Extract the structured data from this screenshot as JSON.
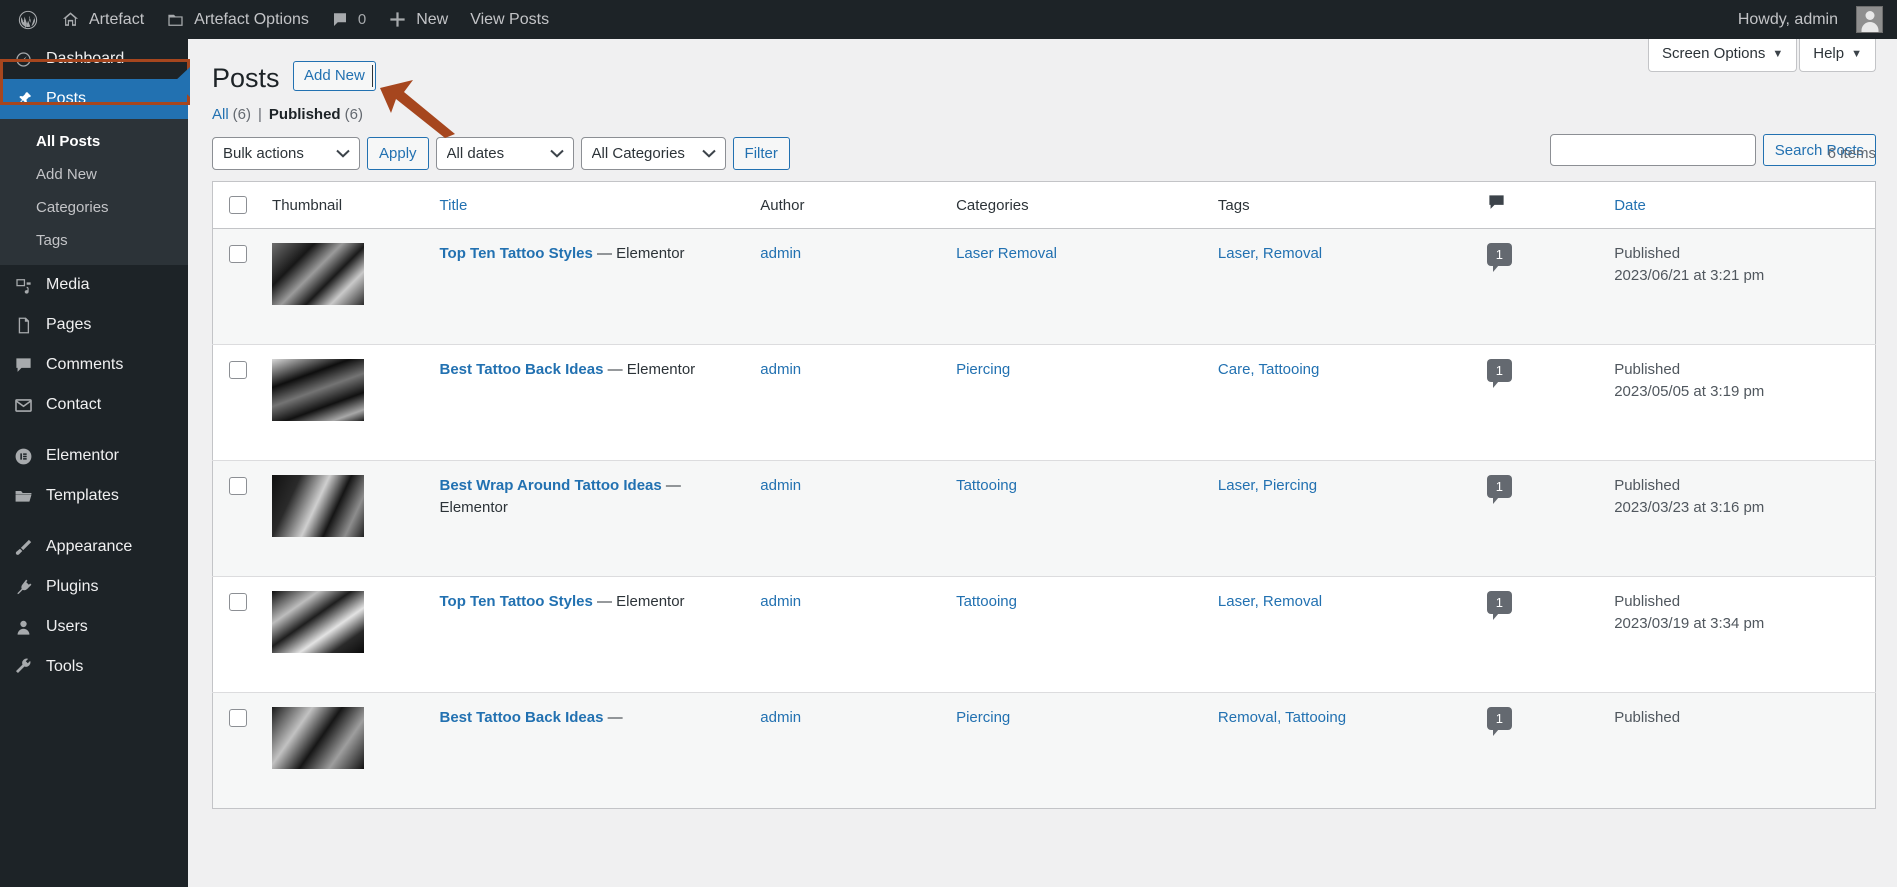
{
  "adminbar": {
    "logo_icon": "wordpress-logo-icon",
    "items": [
      {
        "label": "Artefact",
        "icon": "home-icon"
      },
      {
        "label": "Artefact Options",
        "icon": "briefcase-icon"
      },
      {
        "label": "0",
        "icon": "comment-icon"
      },
      {
        "label": "New",
        "icon": "plus-icon"
      },
      {
        "label": "View Posts",
        "icon": ""
      }
    ],
    "howdy": "Howdy, admin"
  },
  "sidebar": {
    "items": [
      {
        "label": "Dashboard",
        "icon": "dashboard-icon",
        "current": false
      },
      {
        "label": "Posts",
        "icon": "pin-icon",
        "current": true
      },
      {
        "label": "Media",
        "icon": "media-icon",
        "current": false
      },
      {
        "label": "Pages",
        "icon": "pages-icon",
        "current": false
      },
      {
        "label": "Comments",
        "icon": "comments-icon",
        "current": false
      },
      {
        "label": "Contact",
        "icon": "mail-icon",
        "current": false
      },
      {
        "label": "Elementor",
        "icon": "elementor-icon",
        "current": false
      },
      {
        "label": "Templates",
        "icon": "folder-icon",
        "current": false
      },
      {
        "label": "Appearance",
        "icon": "brush-icon",
        "current": false
      },
      {
        "label": "Plugins",
        "icon": "plug-icon",
        "current": false
      },
      {
        "label": "Users",
        "icon": "user-icon",
        "current": false
      },
      {
        "label": "Tools",
        "icon": "wrench-icon",
        "current": false
      }
    ],
    "submenu": [
      {
        "label": "All Posts",
        "current": true
      },
      {
        "label": "Add New",
        "current": false
      },
      {
        "label": "Categories",
        "current": false
      },
      {
        "label": "Tags",
        "current": false
      }
    ],
    "highlight_color": "#a6461e",
    "current_bg": "#2271b1"
  },
  "screen_meta": {
    "screen_options": "Screen Options",
    "help": "Help",
    "caret": "▼"
  },
  "page": {
    "title": "Posts",
    "add_new": "Add New",
    "annotation_arrow_color": "#a6461e"
  },
  "views": {
    "all_label": "All",
    "all_count": "(6)",
    "divider": "|",
    "published_label": "Published",
    "published_count": "(6)"
  },
  "search": {
    "value": "",
    "placeholder": "",
    "button": "Search Posts"
  },
  "tablenav": {
    "bulk_actions": "Bulk actions",
    "apply": "Apply",
    "all_dates": "All dates",
    "all_categories": "All Categories",
    "filter": "Filter",
    "displaying_num": "6 items",
    "chevron": "⌄"
  },
  "table": {
    "columns": {
      "thumbnail": "Thumbnail",
      "title": "Title",
      "author": "Author",
      "categories": "Categories",
      "tags": "Tags",
      "comments_icon": "comment-icon",
      "date": "Date"
    },
    "rows": [
      {
        "title": "Top Ten Tattoo Styles",
        "title_suffix": " — Elementor",
        "author": "admin",
        "categories": "Laser Removal",
        "tags": "Laser, Removal",
        "comments": "1",
        "date_status": "Published",
        "date_value": "2023/06/21 at 3:21 pm"
      },
      {
        "title": "Best Tattoo Back Ideas",
        "title_suffix": " — Elementor",
        "author": "admin",
        "categories": "Piercing",
        "tags": "Care, Tattooing",
        "comments": "1",
        "date_status": "Published",
        "date_value": "2023/05/05 at 3:19 pm"
      },
      {
        "title": "Best Wrap Around Tattoo Ideas",
        "title_suffix": " — Elementor",
        "author": "admin",
        "categories": "Tattooing",
        "tags": "Laser, Piercing",
        "comments": "1",
        "date_status": "Published",
        "date_value": "2023/03/23 at 3:16 pm"
      },
      {
        "title": "Top Ten Tattoo Styles",
        "title_suffix": " — Elementor",
        "author": "admin",
        "categories": "Tattooing",
        "tags": "Laser, Removal",
        "comments": "1",
        "date_status": "Published",
        "date_value": "2023/03/19 at 3:34 pm"
      },
      {
        "title": "Best Tattoo Back Ideas",
        "title_suffix": " —",
        "author": "admin",
        "categories": "Piercing",
        "tags": "Removal, Tattooing",
        "comments": "1",
        "date_status": "Published",
        "date_value": ""
      }
    ]
  }
}
